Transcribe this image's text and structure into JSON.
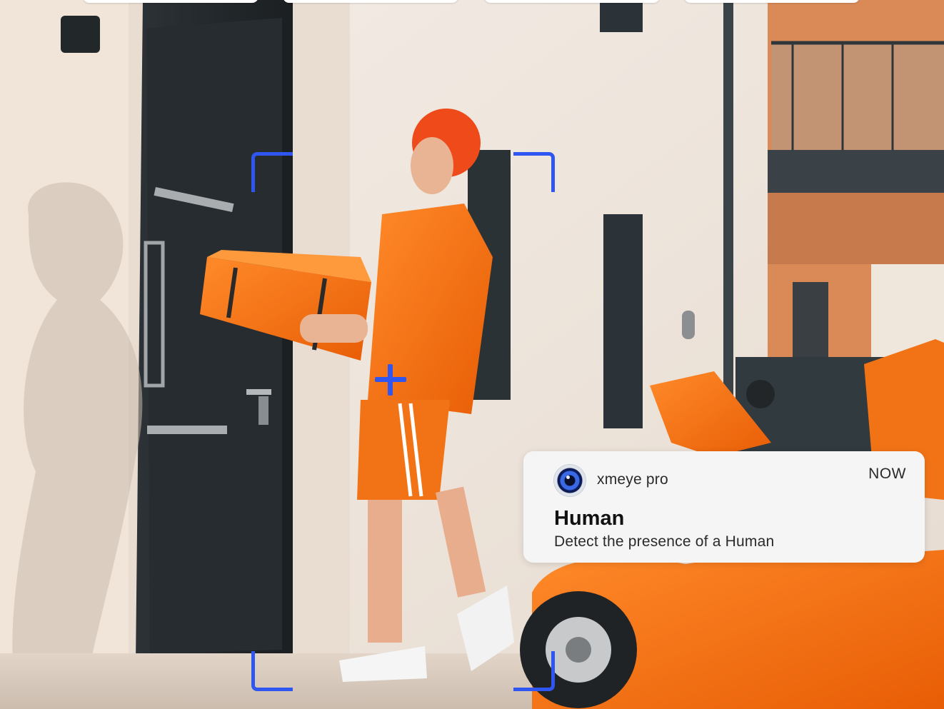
{
  "notification": {
    "app_icon": "camera-lens-icon",
    "app_name": "xmeye pro",
    "time": "NOW",
    "title": "Human",
    "body": "Detect the presence of a Human"
  },
  "detection_overlay": {
    "color": "#2f56f0",
    "marker_icon": "crosshair-plus-icon"
  },
  "colors": {
    "accent": "#2f56f0",
    "notification_bg": "#f5f5f5"
  }
}
